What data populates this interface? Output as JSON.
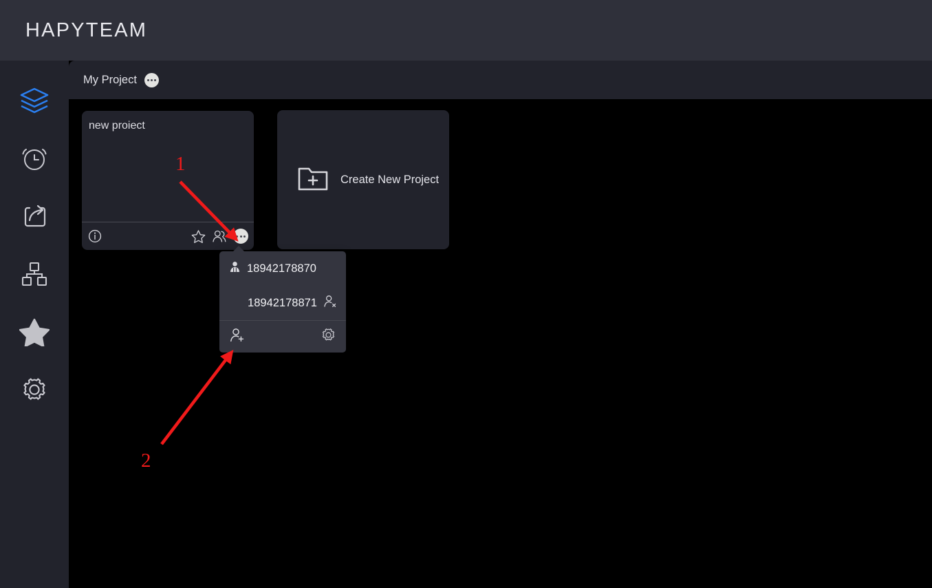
{
  "header": {
    "app_title": "HAPYTEAM",
    "background_color": "#2f303a"
  },
  "sidebar": {
    "background_color": "#22232c",
    "active_color": "#2b7ff0",
    "items": [
      {
        "name": "layers-icon",
        "label": "Projects",
        "active": true
      },
      {
        "name": "alarm-clock-icon",
        "label": "Reminders",
        "active": false
      },
      {
        "name": "share-export-icon",
        "label": "Share",
        "active": false
      },
      {
        "name": "sitemap-icon",
        "label": "Structure",
        "active": false
      },
      {
        "name": "star-filled-icon",
        "label": "Favorites",
        "active": false
      },
      {
        "name": "gear-icon",
        "label": "Settings",
        "active": false
      }
    ]
  },
  "tabbar": {
    "tabs": [
      {
        "label": "My Project",
        "badge": "dots-badge",
        "active": true
      }
    ]
  },
  "content": {
    "background_color": "#000000",
    "project_card": {
      "title": "new proiect",
      "footer_icons": [
        "info-icon",
        "star-outline-icon",
        "people-icon",
        "more-dots-icon"
      ]
    },
    "create_card": {
      "label": "Create New Project",
      "icon": "folder-plus-icon"
    }
  },
  "members_popover": {
    "background_color": "#34353f",
    "members": [
      {
        "name": "18942178870",
        "lead_icon": "user-filled-icon",
        "trail_icon": null,
        "align": "left"
      },
      {
        "name": "18942178871",
        "lead_icon": null,
        "trail_icon": "user-remove-icon",
        "align": "right"
      }
    ],
    "actions": [
      {
        "name": "add-user-icon",
        "label": "Add member"
      },
      {
        "name": "gear-icon",
        "label": "Member settings"
      }
    ]
  },
  "annotations": {
    "color": "#f01a1a",
    "markers": [
      {
        "number": "1",
        "points_to": "people-icon"
      },
      {
        "number": "2",
        "points_to": "add-user-icon"
      }
    ]
  }
}
